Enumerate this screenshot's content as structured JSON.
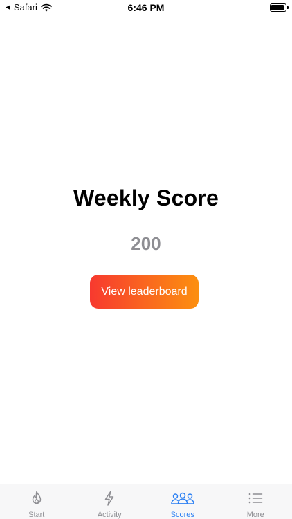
{
  "status_bar": {
    "back_app": "Safari",
    "time": "6:46 PM",
    "battery_level": 0.9
  },
  "main": {
    "title": "Weekly Score",
    "score": "200",
    "button_label": "View leaderboard"
  },
  "tabs": [
    {
      "label": "Start",
      "icon": "flame-icon",
      "active": false
    },
    {
      "label": "Activity",
      "icon": "lightning-icon",
      "active": false
    },
    {
      "label": "Scores",
      "icon": "people-icon",
      "active": true
    },
    {
      "label": "More",
      "icon": "list-icon",
      "active": false
    }
  ],
  "colors": {
    "accent": "#2a7ff3",
    "inactive": "#8e8e93",
    "button_gradient_start": "#f7392f",
    "button_gradient_end": "#fc8f0f"
  }
}
